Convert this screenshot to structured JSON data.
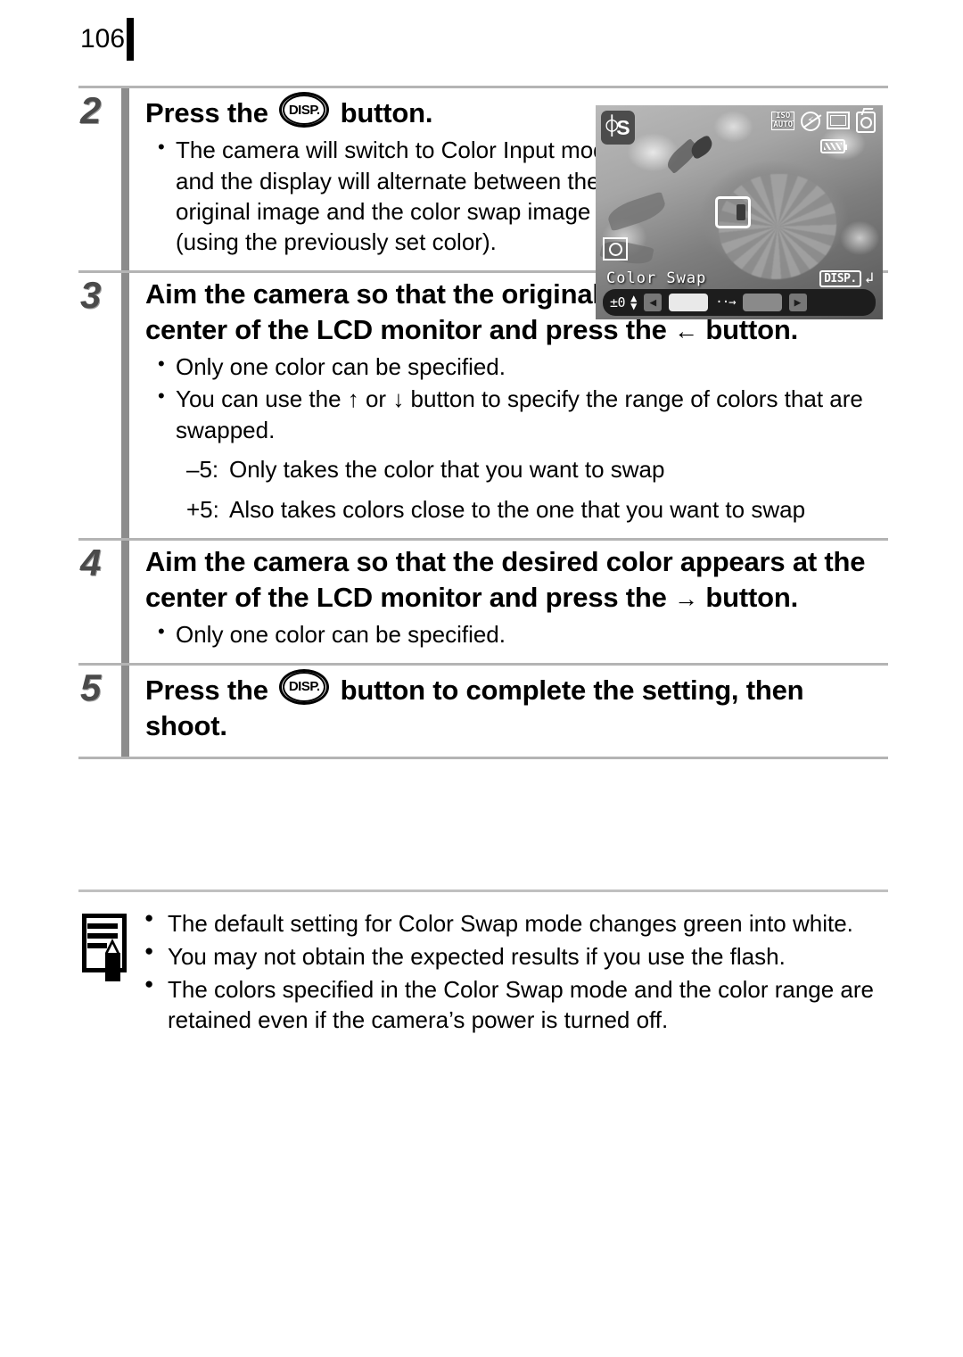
{
  "page": {
    "number": "106"
  },
  "steps": [
    {
      "number": "2",
      "title_before": "Press the",
      "icon": "disp-button-icon",
      "icon_label": "DISP.",
      "title_after": "button.",
      "bullets": [
        "The camera will switch to Color Input mode and the display will alternate between the original image and the color swap image (using the previously set color)."
      ]
    },
    {
      "number": "3",
      "title_before": "Aim the camera so that the original color appears at the center of the LCD monitor and press the",
      "icon": "left-arrow-icon",
      "icon_glyph": "←",
      "title_after": "button.",
      "bullets": [
        "Only one color can be specified.",
        "You can use the ↑ or ↓ button to specify the range of colors that are swapped."
      ],
      "ranges": [
        {
          "label": "–5:",
          "text": "Only takes the color that you want to swap"
        },
        {
          "label": "+5:",
          "text": "Also takes colors close to the one that you want to swap"
        }
      ]
    },
    {
      "number": "4",
      "title_before": "Aim the camera so that the desired color appears at the center of the LCD monitor and press the",
      "icon": "right-arrow-icon",
      "icon_glyph": "→",
      "title_after": "button.",
      "bullets": [
        "Only one color can be specified."
      ]
    },
    {
      "number": "5",
      "title_before": "Press the",
      "icon": "disp-button-icon",
      "icon_label": "DISP.",
      "title_after": "button to complete the setting, then shoot.",
      "bullets": []
    }
  ],
  "lcd": {
    "mode_icon": "color-swap-eyedropper-icon",
    "mode_letter": "S",
    "iso_line1": "ISO",
    "iso_line2": "AUTO",
    "flash_icon": "flash-off-icon",
    "frame_icon": "image-size-icon",
    "camera_icon": "shooting-mode-icon",
    "battery_icon": "battery-icon",
    "metering_icon": "spot-metering-icon",
    "title": "Color Swap",
    "disp_tag": "DISP.",
    "return_icon": "return-arrow-icon",
    "ev_value": "±0",
    "ud_arrows": "▲▼",
    "left_arrow": "◀",
    "right_arrow": "▶",
    "convert_arrow": "··→",
    "source_swatch_color": "#e9e9e9",
    "target_swatch_color": "#8a8a8a"
  },
  "notes": {
    "icon": "note-memo-pencil-icon",
    "items": [
      "The default setting for Color Swap mode changes green into white.",
      "You may not obtain the expected results if you use the flash.",
      "The colors specified in the Color Swap mode and the color range are retained even if the camera’s power is turned off."
    ]
  }
}
